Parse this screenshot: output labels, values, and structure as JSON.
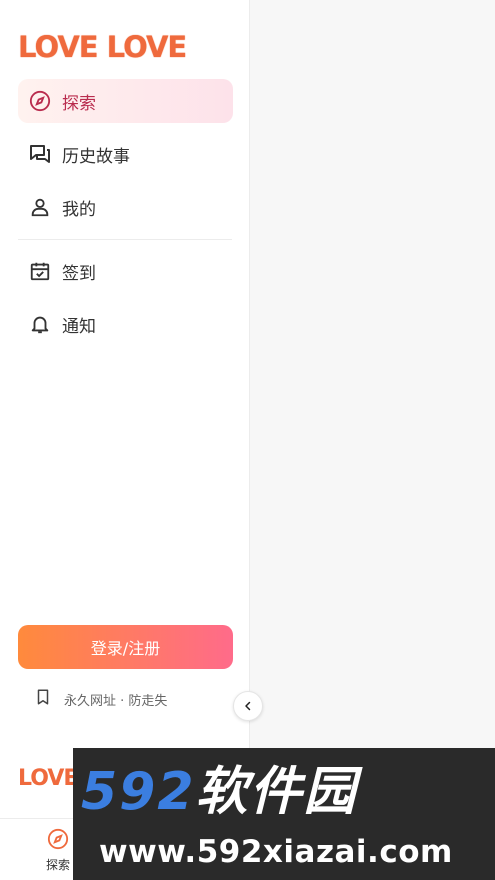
{
  "logo": {
    "text": "LOVE LOVE"
  },
  "nav": {
    "items": [
      {
        "label": "探索",
        "icon": "compass-icon",
        "active": true
      },
      {
        "label": "历史故事",
        "icon": "chat-bubbles-icon"
      },
      {
        "label": "我的",
        "icon": "user-icon"
      },
      {
        "label": "签到",
        "icon": "calendar-check-icon"
      },
      {
        "label": "通知",
        "icon": "bell-icon"
      }
    ]
  },
  "login": {
    "label": "登录/注册"
  },
  "bookmark": {
    "label": "永久网址 · 防走失",
    "icon": "bookmark-icon"
  },
  "collapse": {
    "icon": "chevron-left-icon"
  },
  "tabbar": {
    "explore_label": "探索"
  },
  "watermark": {
    "title_num": "592",
    "title_cn": "软件园",
    "url": "www.592xiazai.com"
  },
  "colors": {
    "accent": "#ef6a3d",
    "active_text": "#b92c4e",
    "login_from": "#ff8a3c",
    "login_to": "#ff6b8a"
  }
}
